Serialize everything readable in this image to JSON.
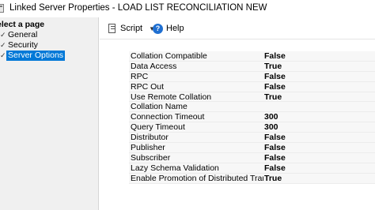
{
  "window": {
    "title": "Linked Server Properties - LOAD LIST RECONCILIATION NEW"
  },
  "left_pane": {
    "header": "elect a page",
    "items": [
      {
        "label": "General",
        "selected": false
      },
      {
        "label": "Security",
        "selected": false
      },
      {
        "label": "Server Options",
        "selected": true
      }
    ]
  },
  "toolbar": {
    "script_label": "Script",
    "help_label": "Help"
  },
  "properties": [
    {
      "name": "Collation Compatible",
      "value": "False"
    },
    {
      "name": "Data Access",
      "value": "True"
    },
    {
      "name": "RPC",
      "value": "False"
    },
    {
      "name": "RPC Out",
      "value": "False"
    },
    {
      "name": "Use Remote Collation",
      "value": "True"
    },
    {
      "name": "Collation Name",
      "value": ""
    },
    {
      "name": "Connection Timeout",
      "value": "300"
    },
    {
      "name": "Query Timeout",
      "value": "300"
    },
    {
      "name": "Distributor",
      "value": "False"
    },
    {
      "name": "Publisher",
      "value": "False"
    },
    {
      "name": "Subscriber",
      "value": "False"
    },
    {
      "name": "Lazy Schema Validation",
      "value": "False"
    },
    {
      "name": "Enable Promotion of Distributed Transaction",
      "value": "True"
    }
  ]
}
